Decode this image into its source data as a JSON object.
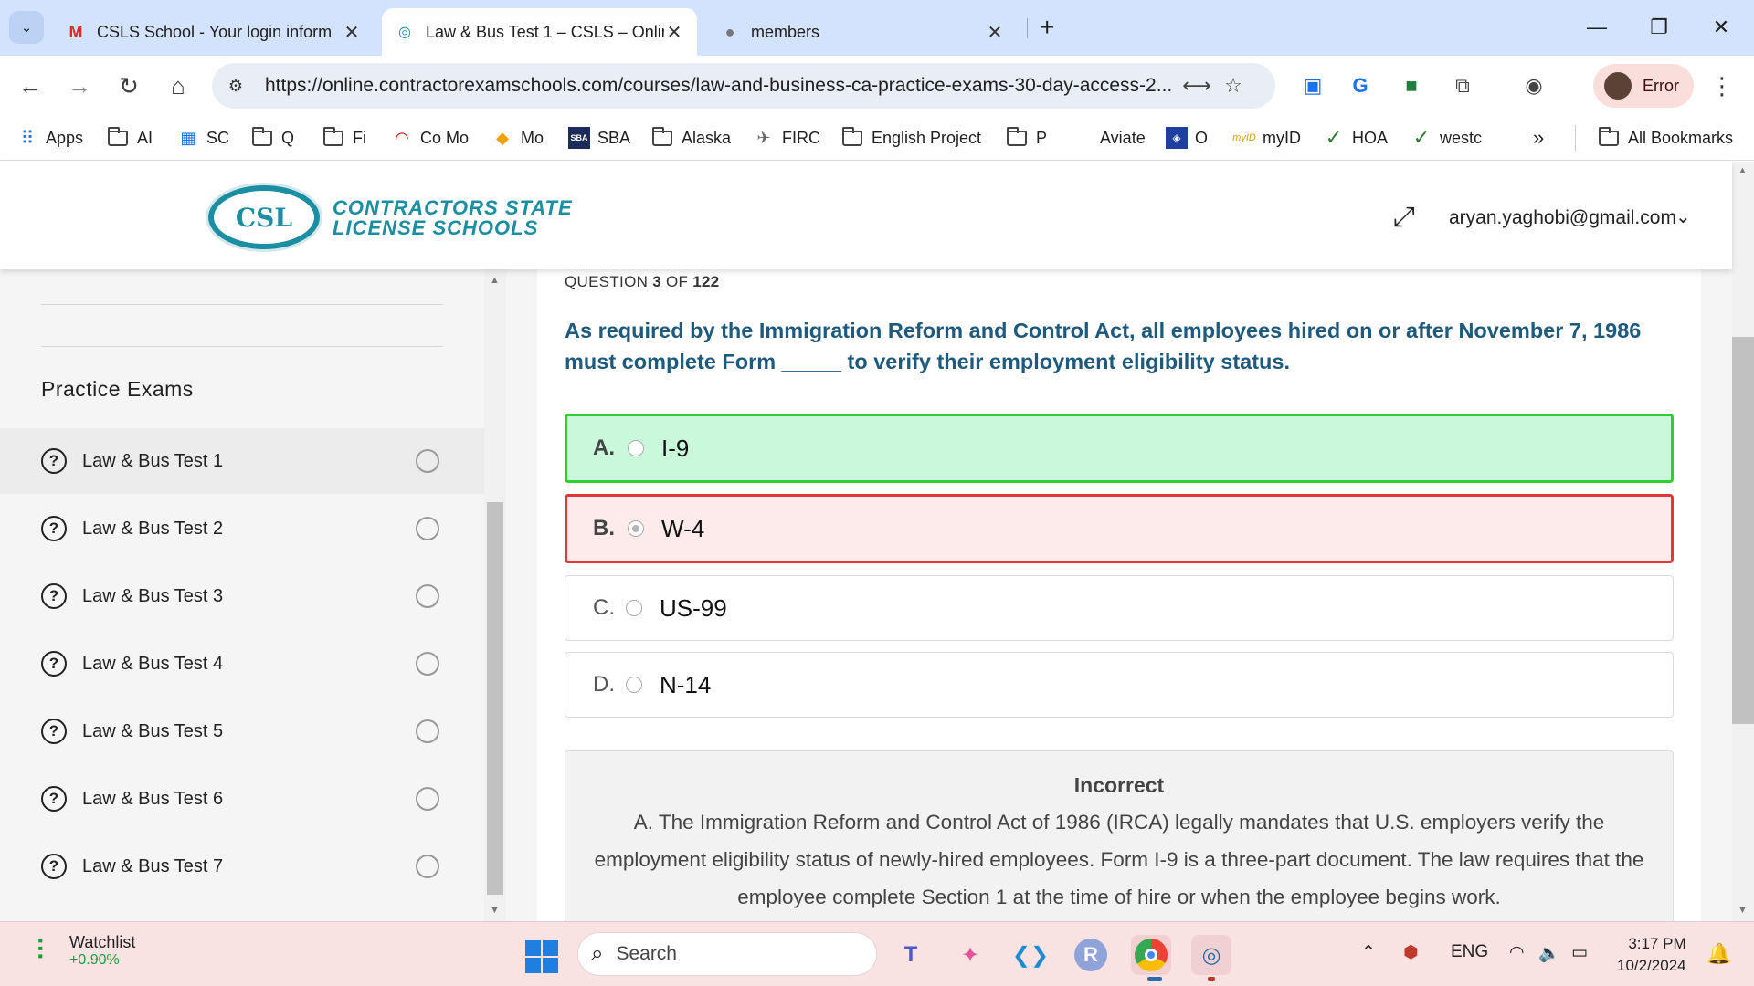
{
  "browser": {
    "tabs": [
      {
        "title": "CSLS School - Your login inform",
        "favicon": "gmail-icon"
      },
      {
        "title": "Law & Bus Test 1 – CSLS – Onlin",
        "favicon": "csls-icon"
      },
      {
        "title": "members",
        "favicon": "globe-icon"
      }
    ],
    "url": "https://online.contractorexamschools.com/courses/law-and-business-ca-practice-exams-30-day-access-2...",
    "profile_label": "Error",
    "bookmarks": [
      "Apps",
      "AI",
      "SC",
      "Q",
      "Fi",
      "Co Mo",
      "Mo",
      "SBA",
      "Alaska",
      "FIRC",
      "English Project",
      "P",
      "Aviate",
      "O",
      "myID",
      "HOA",
      "westc"
    ],
    "more_bookmarks": "»",
    "all_bookmarks": "All Bookmarks"
  },
  "site": {
    "logo_line1": "CONTRACTORS STATE",
    "logo_line2": "LICENSE SCHOOLS",
    "user_email": "aryan.yaghobi@gmail.com"
  },
  "sidebar": {
    "section_title": "Practice Exams",
    "items": [
      {
        "label": "Law & Bus Test 1"
      },
      {
        "label": "Law & Bus Test 2"
      },
      {
        "label": "Law & Bus Test 3"
      },
      {
        "label": "Law & Bus Test 4"
      },
      {
        "label": "Law & Bus Test 5"
      },
      {
        "label": "Law & Bus Test 6"
      },
      {
        "label": "Law & Bus Test 7"
      }
    ]
  },
  "quiz": {
    "question_prefix": "QUESTION",
    "question_current": "3",
    "question_of": "OF",
    "question_total": "122",
    "question_text": "As required by the Immigration Reform and Control Act, all employees hired on or after November 7, 1986 must complete Form _____ to verify their employment eligibility status.",
    "options": [
      {
        "letter": "A.",
        "text": "I-9",
        "state": "correct"
      },
      {
        "letter": "B.",
        "text": "W-4",
        "state": "selected-wrong"
      },
      {
        "letter": "C.",
        "text": "US-99",
        "state": "none"
      },
      {
        "letter": "D.",
        "text": "N-14",
        "state": "none"
      }
    ],
    "feedback_title": "Incorrect",
    "feedback_body": "A. The Immigration Reform and Control Act of 1986 (IRCA) legally mandates that U.S. employers verify the employment eligibility status of newly-hired employees. Form I-9 is a three-part document. The law requires that the employee complete Section 1 at the time of hire or when the employee begins work."
  },
  "taskbar": {
    "widget_title": "Watchlist",
    "widget_value": "+0.90%",
    "search_placeholder": "Search",
    "language": "ENG",
    "time": "3:17 PM",
    "date": "10/2/2024"
  },
  "colors": {
    "accent_teal": "#1c8ea1",
    "question_blue": "#1e5a7d",
    "correct_green": "#2fcf2f",
    "wrong_red": "#e0373d"
  }
}
